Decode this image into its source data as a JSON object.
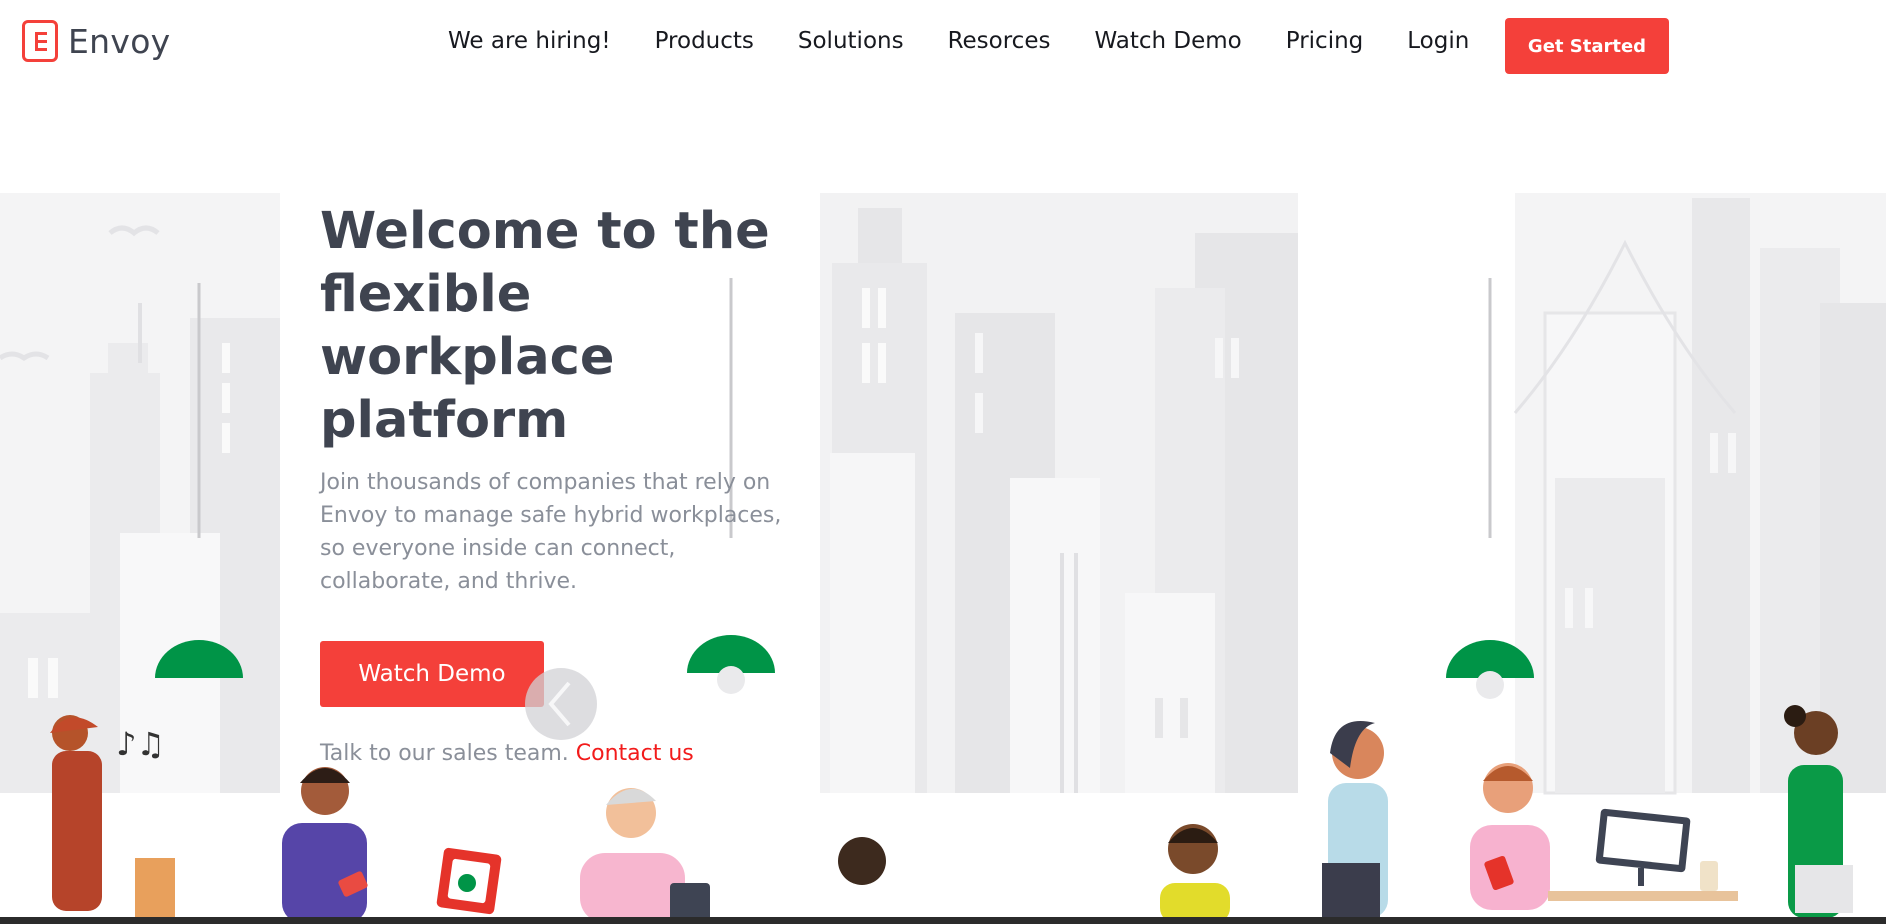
{
  "brand": {
    "name": "Envoy",
    "accent": "#f4403a"
  },
  "nav": {
    "items": [
      "We are hiring!",
      "Products",
      "Solutions",
      "Resorces",
      "Watch Demo",
      "Pricing",
      "Login"
    ],
    "cta": "Get Started"
  },
  "hero": {
    "title": "Welcome to the flexible workplace platform",
    "subtitle": "Join thousands of companies that rely on Envoy to manage safe hybrid workplaces, so everyone inside can connect, collaborate, and thrive.",
    "button": "Watch Demo",
    "sales_text": "Talk to our sales team.",
    "contact_link": "Contact us"
  },
  "icons": {
    "carousel_prev": "chevron-left-icon",
    "logo": "envoy-logo-icon"
  },
  "colors": {
    "lamp": "#009447",
    "building": "#ededef",
    "text": "#3f4450",
    "muted": "#8a8f99",
    "link": "#f21b1b"
  }
}
